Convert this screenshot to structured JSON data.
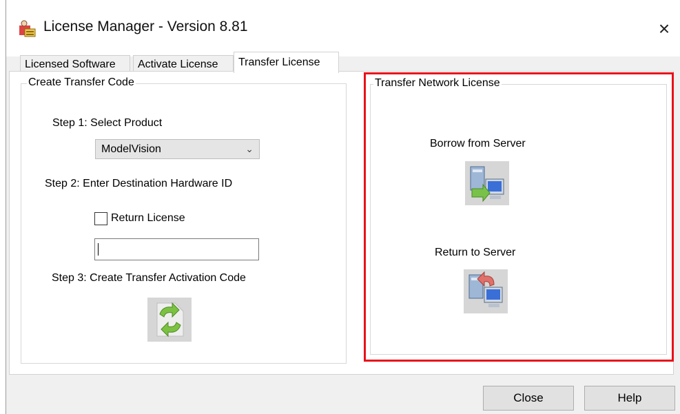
{
  "window": {
    "title": "License Manager - Version 8.81",
    "close_glyph": "×"
  },
  "tabs": [
    {
      "label": "Licensed Software",
      "active": false
    },
    {
      "label": "Activate License",
      "active": false
    },
    {
      "label": "Transfer License",
      "active": true
    }
  ],
  "create_transfer": {
    "group_title": "Create Transfer Code",
    "step1_label": "Step 1: Select Product",
    "product_selected": "ModelVision",
    "step2_label": "Step 2: Enter Destination Hardware ID",
    "return_license_label": "Return License",
    "return_license_checked": false,
    "hardware_id_value": "",
    "step3_label": "Step 3: Create Transfer Activation Code"
  },
  "network": {
    "group_title": "Transfer Network License",
    "borrow_label": "Borrow from Server",
    "return_label": "Return to Server",
    "highlight_color": "#e8101a"
  },
  "buttons": {
    "close": "Close",
    "help": "Help"
  }
}
